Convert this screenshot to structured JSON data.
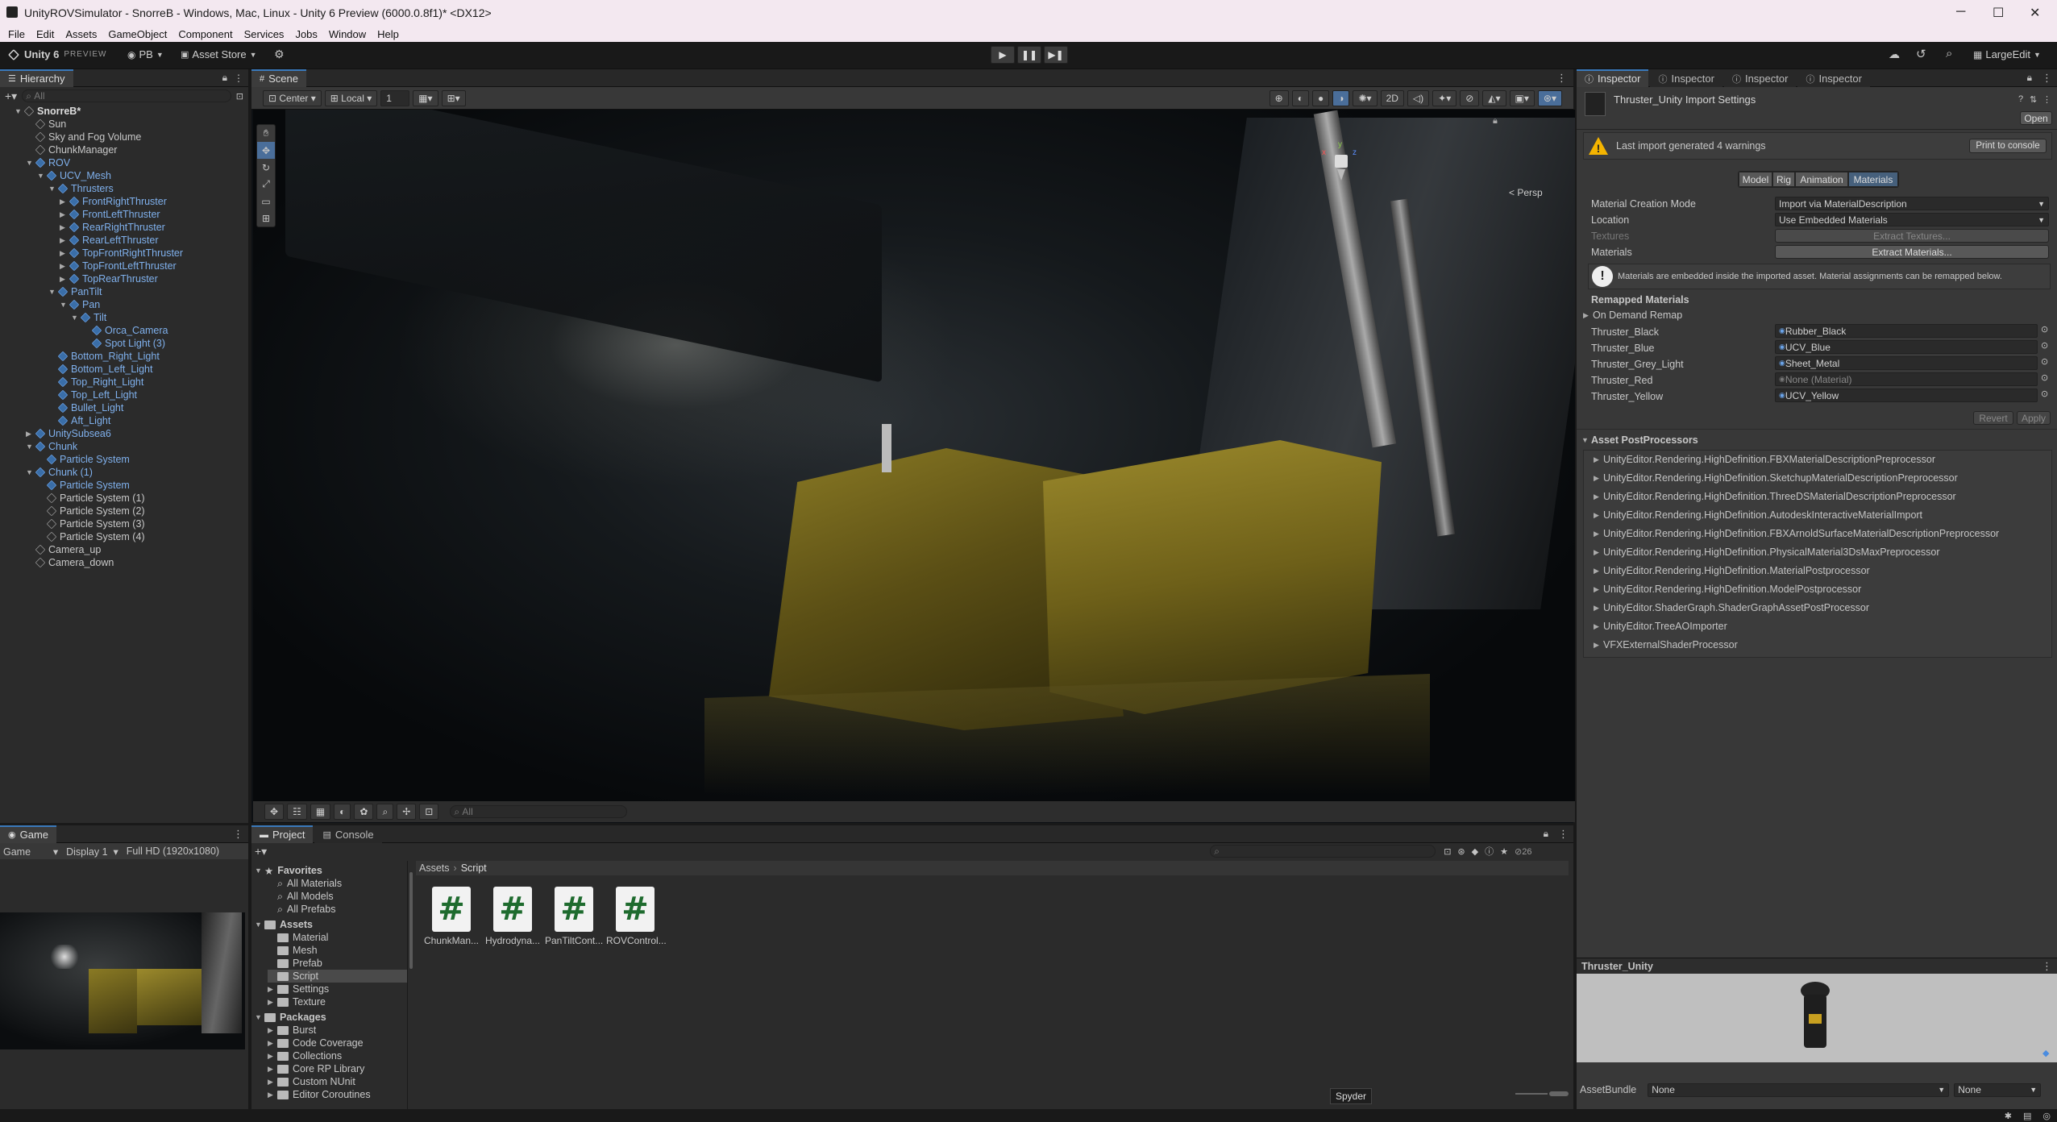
{
  "window": {
    "title": "UnityROVSimulator - SnorreB - Windows, Mac, Linux - Unity 6 Preview (6000.0.8f1)* <DX12>",
    "minimize": "─",
    "maximize": "☐",
    "close": "✕"
  },
  "menu": [
    "File",
    "Edit",
    "Assets",
    "GameObject",
    "Component",
    "Services",
    "Jobs",
    "Window",
    "Help"
  ],
  "toolbar": {
    "unity": "Unity 6",
    "preview": "PREVIEW",
    "account": "PB",
    "asset_store": "Asset Store",
    "layout": "LargeEdit"
  },
  "hierarchy": {
    "tab": "Hierarchy",
    "search": "All",
    "items": [
      {
        "label": "SnorreB*",
        "indent": 0,
        "arrow": "▼",
        "type": "scene"
      },
      {
        "label": "Sun",
        "indent": 1,
        "arrow": "",
        "type": "go"
      },
      {
        "label": "Sky and Fog Volume",
        "indent": 1,
        "arrow": "",
        "type": "go"
      },
      {
        "label": "ChunkManager",
        "indent": 1,
        "arrow": "",
        "type": "go"
      },
      {
        "label": "ROV",
        "indent": 1,
        "arrow": "▼",
        "type": "prefab"
      },
      {
        "label": "UCV_Mesh",
        "indent": 2,
        "arrow": "▼",
        "type": "prefab"
      },
      {
        "label": "Thrusters",
        "indent": 3,
        "arrow": "▼",
        "type": "prefab"
      },
      {
        "label": "FrontRightThruster",
        "indent": 4,
        "arrow": "▶",
        "type": "prefab"
      },
      {
        "label": "FrontLeftThruster",
        "indent": 4,
        "arrow": "▶",
        "type": "prefab"
      },
      {
        "label": "RearRightThruster",
        "indent": 4,
        "arrow": "▶",
        "type": "prefab"
      },
      {
        "label": "RearLeftThruster",
        "indent": 4,
        "arrow": "▶",
        "type": "prefab"
      },
      {
        "label": "TopFrontRightThruster",
        "indent": 4,
        "arrow": "▶",
        "type": "prefab"
      },
      {
        "label": "TopFrontLeftThruster",
        "indent": 4,
        "arrow": "▶",
        "type": "prefab"
      },
      {
        "label": "TopRearThruster",
        "indent": 4,
        "arrow": "▶",
        "type": "prefab"
      },
      {
        "label": "PanTilt",
        "indent": 3,
        "arrow": "▼",
        "type": "prefab"
      },
      {
        "label": "Pan",
        "indent": 4,
        "arrow": "▼",
        "type": "prefab"
      },
      {
        "label": "Tilt",
        "indent": 5,
        "arrow": "▼",
        "type": "prefab"
      },
      {
        "label": "Orca_Camera",
        "indent": 6,
        "arrow": "",
        "type": "prefab"
      },
      {
        "label": "Spot Light (3)",
        "indent": 6,
        "arrow": "",
        "type": "prefab"
      },
      {
        "label": "Bottom_Right_Light",
        "indent": 3,
        "arrow": "",
        "type": "prefab"
      },
      {
        "label": "Bottom_Left_Light",
        "indent": 3,
        "arrow": "",
        "type": "prefab"
      },
      {
        "label": "Top_Right_Light",
        "indent": 3,
        "arrow": "",
        "type": "prefab"
      },
      {
        "label": "Top_Left_Light",
        "indent": 3,
        "arrow": "",
        "type": "prefab"
      },
      {
        "label": "Bullet_Light",
        "indent": 3,
        "arrow": "",
        "type": "prefab"
      },
      {
        "label": "Aft_Light",
        "indent": 3,
        "arrow": "",
        "type": "prefab"
      },
      {
        "label": "UnitySubsea6",
        "indent": 1,
        "arrow": "▶",
        "type": "prefab"
      },
      {
        "label": "Chunk",
        "indent": 1,
        "arrow": "▼",
        "type": "prefab"
      },
      {
        "label": "Particle System",
        "indent": 2,
        "arrow": "",
        "type": "prefab"
      },
      {
        "label": "Chunk (1)",
        "indent": 1,
        "arrow": "▼",
        "type": "prefab"
      },
      {
        "label": "Particle System",
        "indent": 2,
        "arrow": "",
        "type": "prefab"
      },
      {
        "label": "Particle System (1)",
        "indent": 2,
        "arrow": "",
        "type": "go"
      },
      {
        "label": "Particle System (2)",
        "indent": 2,
        "arrow": "",
        "type": "go"
      },
      {
        "label": "Particle System (3)",
        "indent": 2,
        "arrow": "",
        "type": "go"
      },
      {
        "label": "Particle System (4)",
        "indent": 2,
        "arrow": "",
        "type": "go"
      },
      {
        "label": "Camera_up",
        "indent": 1,
        "arrow": "",
        "type": "go"
      },
      {
        "label": "Camera_down",
        "indent": 1,
        "arrow": "",
        "type": "go"
      }
    ]
  },
  "scene": {
    "tab": "Scene",
    "pivot": "Center",
    "space": "Local",
    "snap": "1",
    "persp": "< Persp",
    "mode2d": "2D",
    "search": "All",
    "gizmo": {
      "x": "x",
      "y": "y",
      "z": "z"
    }
  },
  "inspector": {
    "tabs": [
      "Inspector",
      "Inspector",
      "Inspector",
      "Inspector"
    ],
    "title": "Thruster_Unity Import Settings",
    "open": "Open",
    "warning": "Last import generated 4 warnings",
    "print_console": "Print to console",
    "subtabs": [
      "Model",
      "Rig",
      "Animation",
      "Materials"
    ],
    "fields": [
      {
        "label": "Material Creation Mode",
        "value": "Import via MaterialDescription"
      },
      {
        "label": "Location",
        "value": "Use Embedded Materials"
      },
      {
        "label": "Textures",
        "value": "Extract Textures..."
      },
      {
        "label": "Materials",
        "value": "Extract Materials..."
      }
    ],
    "info": "Materials are embedded inside the imported asset. Material assignments can be remapped below.",
    "remapped_header": "Remapped Materials",
    "on_demand": "On Demand Remap",
    "remaps": [
      {
        "label": "Thruster_Black",
        "value": "Rubber_Black"
      },
      {
        "label": "Thruster_Blue",
        "value": "UCV_Blue"
      },
      {
        "label": "Thruster_Grey_Light",
        "value": "Sheet_Metal"
      },
      {
        "label": "Thruster_Red",
        "value": "None (Material)"
      },
      {
        "label": "Thruster_Yellow",
        "value": "UCV_Yellow"
      }
    ],
    "revert": "Revert",
    "apply": "Apply",
    "postprocessors_header": "Asset PostProcessors",
    "postprocessors": [
      "UnityEditor.Rendering.HighDefinition.FBXMaterialDescriptionPreprocessor",
      "UnityEditor.Rendering.HighDefinition.SketchupMaterialDescriptionPreprocessor",
      "UnityEditor.Rendering.HighDefinition.ThreeDSMaterialDescriptionPreprocessor",
      "UnityEditor.Rendering.HighDefinition.AutodeskInteractiveMaterialImport",
      "UnityEditor.Rendering.HighDefinition.FBXArnoldSurfaceMaterialDescriptionPreprocessor",
      "UnityEditor.Rendering.HighDefinition.PhysicalMaterial3DsMaxPreprocessor",
      "UnityEditor.Rendering.HighDefinition.MaterialPostprocessor",
      "UnityEditor.Rendering.HighDefinition.ModelPostprocessor",
      "UnityEditor.ShaderGraph.ShaderGraphAssetPostProcessor",
      "UnityEditor.TreeAOImporter",
      "VFXExternalShaderProcessor"
    ],
    "preview_title": "Thruster_Unity",
    "assetbundle_label": "AssetBundle",
    "assetbundle": "None",
    "variant": "None"
  },
  "game": {
    "tab": "Game",
    "mode": "Game",
    "display": "Display 1",
    "resolution": "Full HD (1920x1080)"
  },
  "project": {
    "tabs": [
      "Project",
      "Console"
    ],
    "breadcrumb": [
      "Assets",
      "Script"
    ],
    "count": "26",
    "tree": [
      {
        "label": "Favorites",
        "indent": 0,
        "kind": "star",
        "bold": true
      },
      {
        "label": "All Materials",
        "indent": 1,
        "kind": "search"
      },
      {
        "label": "All Models",
        "indent": 1,
        "kind": "search"
      },
      {
        "label": "All Prefabs",
        "indent": 1,
        "kind": "search"
      },
      {
        "label": "Assets",
        "indent": 0,
        "kind": "folder",
        "bold": true
      },
      {
        "label": "Material",
        "indent": 1,
        "kind": "folder"
      },
      {
        "label": "Mesh",
        "indent": 1,
        "kind": "folder"
      },
      {
        "label": "Prefab",
        "indent": 1,
        "kind": "folder"
      },
      {
        "label": "Script",
        "indent": 1,
        "kind": "folder",
        "selected": true
      },
      {
        "label": "Settings",
        "indent": 1,
        "kind": "folder",
        "arrow": true
      },
      {
        "label": "Texture",
        "indent": 1,
        "kind": "folder",
        "arrow": true
      },
      {
        "label": "Packages",
        "indent": 0,
        "kind": "folder",
        "bold": true
      },
      {
        "label": "Burst",
        "indent": 1,
        "kind": "folder",
        "arrow": true
      },
      {
        "label": "Code Coverage",
        "indent": 1,
        "kind": "folder",
        "arrow": true
      },
      {
        "label": "Collections",
        "indent": 1,
        "kind": "folder",
        "arrow": true
      },
      {
        "label": "Core RP Library",
        "indent": 1,
        "kind": "folder",
        "arrow": true
      },
      {
        "label": "Custom NUnit",
        "indent": 1,
        "kind": "folder",
        "arrow": true
      },
      {
        "label": "Editor Coroutines",
        "indent": 1,
        "kind": "folder",
        "arrow": true
      }
    ],
    "assets": [
      "ChunkMan...",
      "Hydrodyna...",
      "PanTiltCont...",
      "ROVControl..."
    ],
    "tooltip": "Spyder"
  }
}
